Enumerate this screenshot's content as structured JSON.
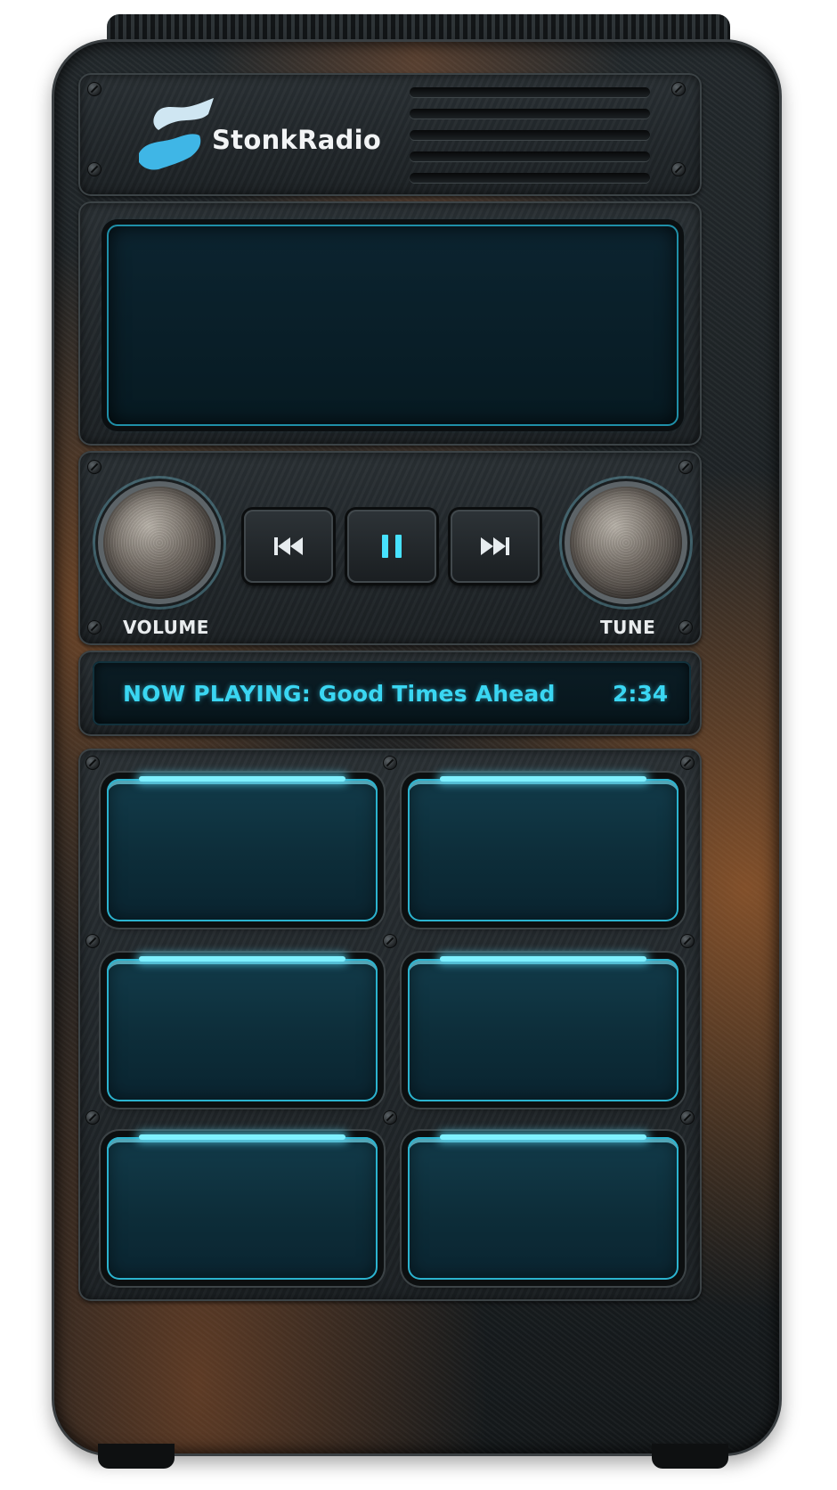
{
  "brand": {
    "name": "StonkRadio",
    "logo_icon": "stonk-logo-icon",
    "logo_color": "#3fb6e6"
  },
  "display": {
    "accent_color": "#1f8fa8"
  },
  "controls": {
    "volume_label": "VOLUME",
    "tune_label": "TUNE",
    "prev_icon": "skip-back-icon",
    "pause_icon": "pause-icon",
    "next_icon": "skip-forward-icon",
    "active_color": "#3ad6f2"
  },
  "now_playing": {
    "text": "NOW PLAYING: Good Times Ahead",
    "time": "2:34"
  },
  "presets": {
    "count": 6,
    "glow_color": "#7ff0ff"
  }
}
